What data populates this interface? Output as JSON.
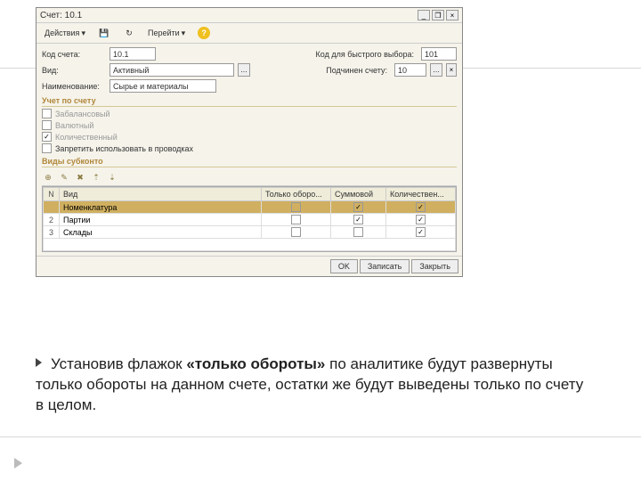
{
  "window": {
    "title": "Счет: 10.1"
  },
  "toolbar": {
    "actions": "Действия",
    "go": "Перейти"
  },
  "fields": {
    "kod_lbl": "Код счета:",
    "kod": "10.1",
    "quick_lbl": "Код для быстрого выбора:",
    "quick": "101",
    "vid_lbl": "Вид:",
    "vid": "Активный",
    "sub_lbl": "Подчинен счету:",
    "sub": "10",
    "name_lbl": "Наименование:",
    "name": "Сырье и материалы"
  },
  "acct": {
    "title": "Учет по счету",
    "c1": "Забалансовый",
    "c2": "Валютный",
    "c3": "Количественный",
    "c4": "Запретить использовать в проводках"
  },
  "subk": {
    "title": "Виды субконто"
  },
  "grid": {
    "h_n": "N",
    "h_vid": "Вид",
    "h_oboro": "Только оборо...",
    "h_sum": "Суммовой",
    "h_kol": "Количествен...",
    "rows": [
      {
        "n": "",
        "vid": "Номенклатура",
        "o": false,
        "s": true,
        "k": true,
        "sel": true
      },
      {
        "n": "2",
        "vid": "Партии",
        "o": false,
        "s": true,
        "k": true
      },
      {
        "n": "3",
        "vid": "Склады",
        "o": false,
        "s": false,
        "k": true
      }
    ]
  },
  "footer": {
    "ok": "OK",
    "save": "Записать",
    "close": "Закрыть"
  },
  "caption": {
    "t1": "Установив флажок ",
    "bold": "«только обороты»",
    "t2": " по аналитике будут развернуты только обороты на данном счете, остатки же будут выведены только по счету в целом."
  }
}
